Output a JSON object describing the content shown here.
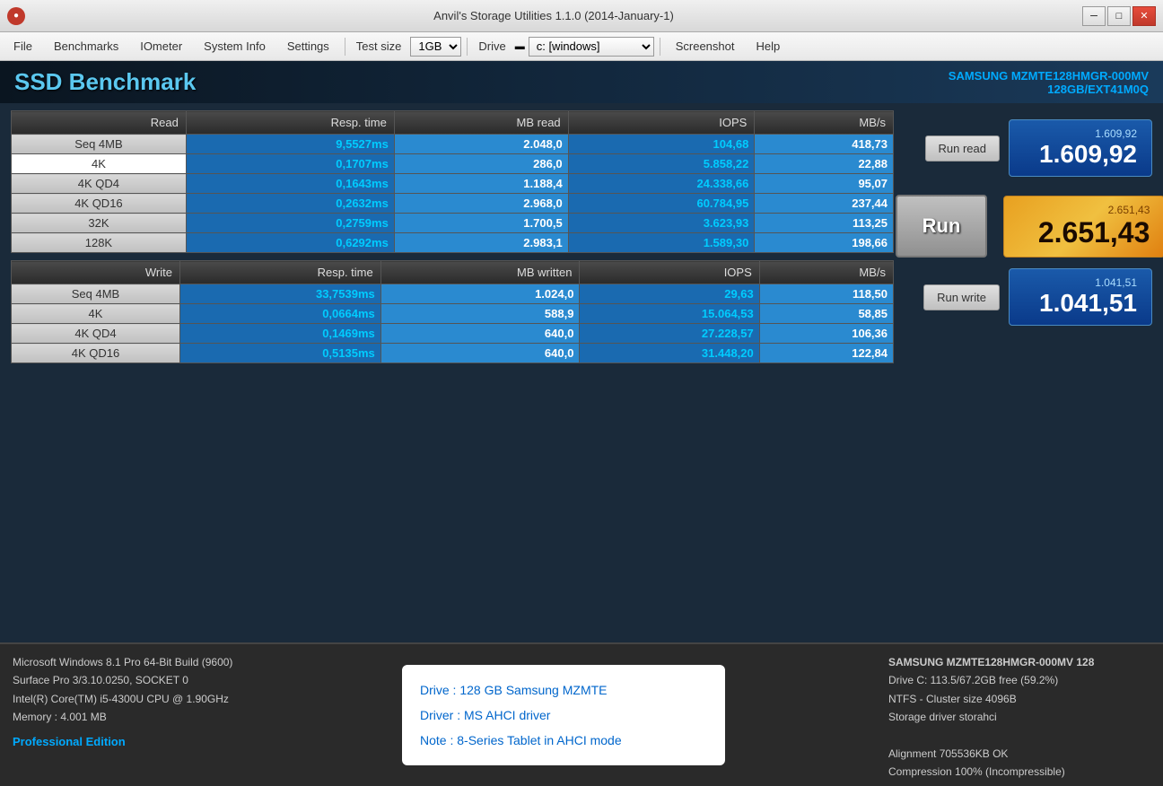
{
  "titleBar": {
    "title": "Anvil's Storage Utilities 1.1.0 (2014-January-1)",
    "icon": "●",
    "minimize": "─",
    "maximize": "□",
    "close": "✕"
  },
  "menuBar": {
    "file": "File",
    "benchmarks": "Benchmarks",
    "iometer": "IOmeter",
    "systemInfo": "System Info",
    "settings": "Settings",
    "testSizeLabel": "Test size",
    "testSizeValue": "1GB",
    "driveLabel": "Drive",
    "driveIcon": "▬",
    "driveValue": "c: [windows]",
    "screenshot": "Screenshot",
    "help": "Help"
  },
  "header": {
    "title": "SSD Benchmark",
    "driveModel": "SAMSUNG MZMTE128HMGR-000MV",
    "driveDetails": "128GB/EXT41M0Q"
  },
  "readTable": {
    "headers": [
      "Read",
      "Resp. time",
      "MB read",
      "IOPS",
      "MB/s"
    ],
    "rows": [
      {
        "label": "Seq 4MB",
        "labelStyle": "normal",
        "respTime": "9,5527ms",
        "mb": "2.048,0",
        "iops": "104,68",
        "mbs": "418,73"
      },
      {
        "label": "4K",
        "labelStyle": "selected",
        "respTime": "0,1707ms",
        "mb": "286,0",
        "iops": "5.858,22",
        "mbs": "22,88"
      },
      {
        "label": "4K QD4",
        "labelStyle": "normal",
        "respTime": "0,1643ms",
        "mb": "1.188,4",
        "iops": "24.338,66",
        "mbs": "95,07"
      },
      {
        "label": "4K QD16",
        "labelStyle": "normal",
        "respTime": "0,2632ms",
        "mb": "2.968,0",
        "iops": "60.784,95",
        "mbs": "237,44"
      },
      {
        "label": "32K",
        "labelStyle": "normal",
        "respTime": "0,2759ms",
        "mb": "1.700,5",
        "iops": "3.623,93",
        "mbs": "113,25"
      },
      {
        "label": "128K",
        "labelStyle": "normal",
        "respTime": "0,6292ms",
        "mb": "2.983,1",
        "iops": "1.589,30",
        "mbs": "198,66"
      }
    ]
  },
  "writeTable": {
    "headers": [
      "Write",
      "Resp. time",
      "MB written",
      "IOPS",
      "MB/s"
    ],
    "rows": [
      {
        "label": "Seq 4MB",
        "labelStyle": "normal",
        "respTime": "33,7539ms",
        "mb": "1.024,0",
        "iops": "29,63",
        "mbs": "118,50"
      },
      {
        "label": "4K",
        "labelStyle": "normal",
        "respTime": "0,0664ms",
        "mb": "588,9",
        "iops": "15.064,53",
        "mbs": "58,85"
      },
      {
        "label": "4K QD4",
        "labelStyle": "normal",
        "respTime": "0,1469ms",
        "mb": "640,0",
        "iops": "27.228,57",
        "mbs": "106,36"
      },
      {
        "label": "4K QD16",
        "labelStyle": "normal",
        "respTime": "0,5135ms",
        "mb": "640,0",
        "iops": "31.448,20",
        "mbs": "122,84"
      }
    ]
  },
  "controls": {
    "runReadLabel": "Run read",
    "runLabel": "Run",
    "runWriteLabel": "Run write"
  },
  "scores": {
    "readLabel": "1.609,92",
    "readValue": "1.609,92",
    "totalLabel": "2.651,43",
    "totalValue": "2.651,43",
    "writeLabel": "1.041,51",
    "writeValue": "1.041,51"
  },
  "bottomBar": {
    "sysInfo1": "Microsoft Windows 8.1 Pro 64-Bit Build (9600)",
    "sysInfo2": "Surface Pro 3/3.10.0250, SOCKET 0",
    "sysInfo3": "Intel(R) Core(TM) i5-4300U CPU @ 1.90GHz",
    "sysInfo4": "Memory : 4.001 MB",
    "edition": "Professional Edition",
    "driveInfoTitle": "Drive : 128 GB Samsung MZMTE",
    "driveInfoDriver": "Driver : MS AHCI driver",
    "driveInfoNote": "Note : 8-Series Tablet in AHCI mode",
    "rightDriveName": "SAMSUNG MZMTE128HMGR-000MV 128",
    "rightLine1": "Drive C: 113.5/67.2GB free (59.2%)",
    "rightLine2": "NTFS - Cluster size 4096B",
    "rightLine3": "Storage driver  storahci",
    "rightLine4": "",
    "rightLine5": "Alignment 705536KB OK",
    "rightLine6": "Compression 100% (Incompressible)"
  }
}
